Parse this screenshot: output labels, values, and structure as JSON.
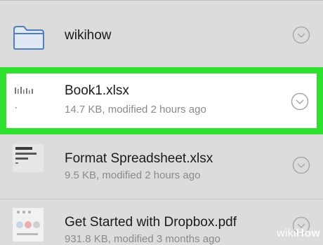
{
  "files": [
    {
      "name": "wikihow",
      "meta": "",
      "icon": "folder-icon"
    },
    {
      "name": "Book1.xlsx",
      "meta": "14.7 KB, modified 2 hours ago",
      "icon": "spreadsheet-thumbnail-icon",
      "selected": true
    },
    {
      "name": "Format Spreadsheet.xlsx",
      "meta": "9.5 KB, modified 2 hours ago",
      "icon": "spreadsheet-thumbnail-icon"
    },
    {
      "name": "Get Started with Dropbox.pdf",
      "meta": "931.8 KB, modified 3 months ago",
      "icon": "pdf-thumbnail-icon"
    }
  ],
  "watermark": {
    "prefix": "wiki",
    "suffix": "How"
  },
  "colors": {
    "background": "#dcdcdc",
    "highlight": "#2fe02f",
    "folder": "#5b8fd0",
    "chevron": "#a8a8a8"
  }
}
